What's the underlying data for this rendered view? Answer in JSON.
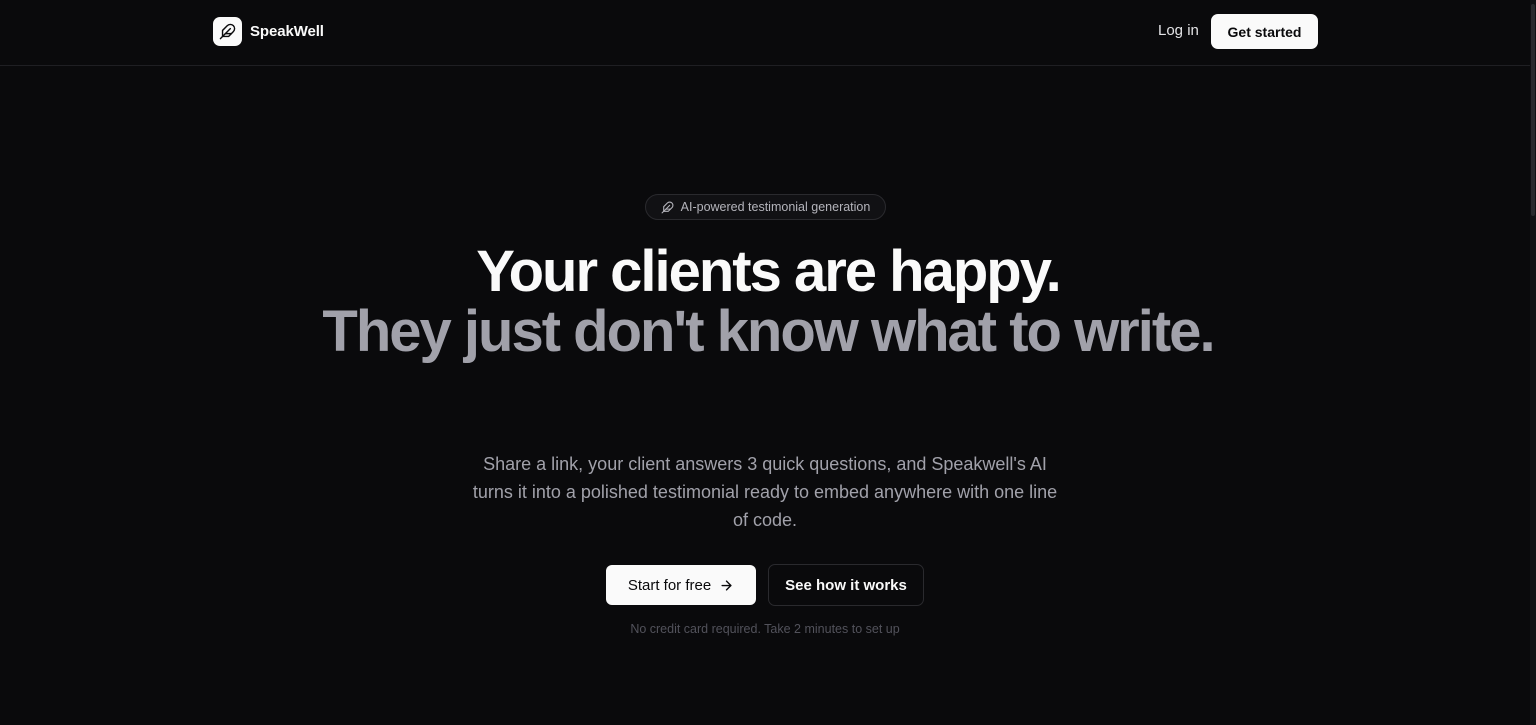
{
  "header": {
    "brand_name": "SpeakWell",
    "login_label": "Log in",
    "get_started_label": "Get started"
  },
  "hero": {
    "badge_icon": "feather-icon",
    "badge_text": "AI-powered testimonial generation",
    "headline_line1": "Your clients are happy.",
    "headline_line2": "They just don't know what to write.",
    "subtitle": "Share a link, your client answers 3 quick questions, and Speakwell's AI turns it into a polished testimonial ready to embed anywhere with one line of code.",
    "primary_cta": "Start for free",
    "primary_cta_icon": "arrow-right-icon",
    "secondary_cta": "See how it works",
    "note": "No credit card required. Take 2 minutes to set up"
  },
  "colors": {
    "background": "#0a0a0c",
    "text_primary": "#fafafa",
    "text_muted": "#a1a1aa",
    "button_bg": "#fafafa"
  }
}
